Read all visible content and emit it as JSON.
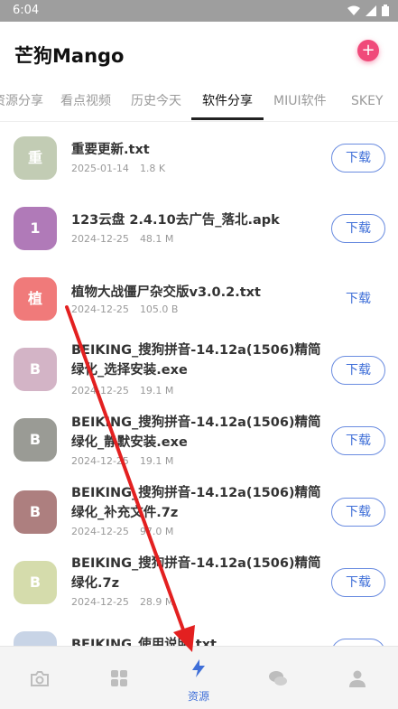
{
  "status": {
    "time": "6:04"
  },
  "header": {
    "title": "芒狗Mango",
    "add_symbol": "+"
  },
  "tabs": [
    {
      "label": "资源分享"
    },
    {
      "label": "看点视频"
    },
    {
      "label": "历史今天"
    },
    {
      "label": "软件分享",
      "active": true
    },
    {
      "label": "MIUI软件"
    },
    {
      "label": "SKEY"
    }
  ],
  "files": [
    {
      "icon_char": "重",
      "icon_color": "#c2ccb4",
      "name": "重要更新.txt",
      "date": "2025-01-14",
      "size": "1.8 K",
      "button": "下载",
      "button_border": true
    },
    {
      "icon_char": "1",
      "icon_color": "#b07ab8",
      "name": "123云盘 2.4.10去广告_落北.apk",
      "date": "2024-12-25",
      "size": "48.1 M",
      "button": "下载",
      "button_border": true
    },
    {
      "icon_char": "植",
      "icon_color": "#f07a7a",
      "name": "植物大战僵尸杂交版v3.0.2.txt",
      "date": "2024-12-25",
      "size": "105.0 B",
      "button": "下载",
      "button_border": false
    },
    {
      "icon_char": "B",
      "icon_color": "#d3b4c6",
      "name": "BEIKING_搜狗拼音-14.12a(1506)精简绿化_选择安装.exe",
      "date": "2024-12-25",
      "size": "19.1 M",
      "button": "下载",
      "button_border": true
    },
    {
      "icon_char": "B",
      "icon_color": "#9a9b95",
      "name": "BEIKING_搜狗拼音-14.12a(1506)精简绿化_静默安装.exe",
      "date": "2024-12-25",
      "size": "19.1 M",
      "button": "下载",
      "button_border": true
    },
    {
      "icon_char": "B",
      "icon_color": "#ad7f7f",
      "name": "BEIKING_搜狗拼音-14.12a(1506)精简绿化_补充文件.7z",
      "date": "2024-12-25",
      "size": "97.0 M",
      "button": "下载",
      "button_border": true
    },
    {
      "icon_char": "B",
      "icon_color": "#d5dcac",
      "name": "BEIKING_搜狗拼音-14.12a(1506)精简绿化.7z",
      "date": "2024-12-25",
      "size": "28.9 M",
      "button": "下载",
      "button_border": true
    },
    {
      "icon_char": "",
      "icon_color": "#c8d4e6",
      "name": "BEIKING_使用说明.txt",
      "date": "",
      "size": "",
      "button": "",
      "button_border": true
    }
  ],
  "bottom_nav": [
    {
      "icon": "camera-icon",
      "label": ""
    },
    {
      "icon": "grid-icon",
      "label": ""
    },
    {
      "icon": "lightning-icon",
      "label": "资源",
      "active": true
    },
    {
      "icon": "chat-icon",
      "label": ""
    },
    {
      "icon": "person-icon",
      "label": ""
    }
  ],
  "colors": {
    "accent": "#3f6fd8",
    "annotation_arrow": "#e32020"
  }
}
